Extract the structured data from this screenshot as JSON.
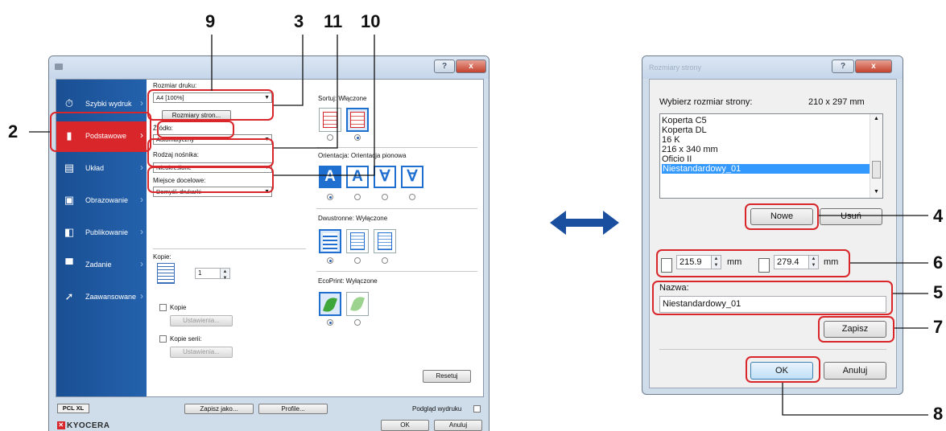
{
  "callouts": {
    "c9": "9",
    "c3": "3",
    "c11": "11",
    "c10": "10",
    "c2": "2",
    "c4": "4",
    "c6": "6",
    "c5": "5",
    "c7": "7",
    "c8": "8"
  },
  "print_dialog": {
    "sidebar": [
      {
        "label": "Szybki wydruk",
        "icon": "stopwatch-icon"
      },
      {
        "label": "Podstawowe",
        "icon": "document-icon",
        "active": true
      },
      {
        "label": "Układ",
        "icon": "layout-icon"
      },
      {
        "label": "Obrazowanie",
        "icon": "image-icon"
      },
      {
        "label": "Publikowanie",
        "icon": "publishing-icon"
      },
      {
        "label": "Zadanie",
        "icon": "job-icon"
      },
      {
        "label": "Zaawansowane",
        "icon": "arrow-icon"
      }
    ],
    "print_size_label": "Rozmiar druku:",
    "print_size_value": "A4 [100%]",
    "page_sizes_button": "Rozmiary stron...",
    "source_label": "Źródło:",
    "source_value": "Automatyczny",
    "media_type_label": "Rodzaj nośnika:",
    "media_type_value": "Nieokreślone",
    "destination_label": "Miejsce docelowe:",
    "destination_value": "Domyśl. drukarki",
    "copies_label": "Kopie:",
    "copies_value": "1",
    "copies_check_label": "Kopie",
    "settings_button_1": "Ustawienia...",
    "copy_series_label": "Kopie serii:",
    "settings_button_2": "Ustawienia...",
    "collate_label": "Sortuj:  Włączone",
    "orientation_label": "Orientacja:  Orientacja pionowa",
    "duplex_label": "Dwustronne:  Wyłączone",
    "ecoprint_label": "EcoPrint:  Wyłączone",
    "reset_button": "Resetuj",
    "pcl_button": "PCL XL",
    "save_as_button": "Zapisz jako...",
    "profiles_button": "Profile...",
    "preview_label": "Podgląd wydruku",
    "ok_button": "OK",
    "cancel_button": "Anuluj",
    "brand": "KYOCERA",
    "help_glyph": "?",
    "close_glyph": "x"
  },
  "page_size_dialog": {
    "title": "Rozmiary strony",
    "select_label": "Wybierz rozmiar strony:",
    "current_size": "210 x 297 mm",
    "sizes": [
      "Koperta C5",
      "Koperta DL",
      "16 K",
      "216 x 340 mm",
      "Oficio II",
      "Niestandardowy_01"
    ],
    "selected_index": 5,
    "new_button": "Nowe",
    "delete_button": "Usuń",
    "width_value": "215.9",
    "height_value": "279.4",
    "unit": "mm",
    "name_label": "Nazwa:",
    "name_value": "Niestandardowy_01",
    "save_button": "Zapisz",
    "ok_button": "OK",
    "cancel_button": "Anuluj",
    "help_glyph": "?",
    "close_glyph": "x"
  },
  "colors": {
    "sidebar_blue": "#1a4f93",
    "active_red": "#d8262a",
    "selection_blue": "#3399ff",
    "accent_blue": "#1f6fd0"
  }
}
